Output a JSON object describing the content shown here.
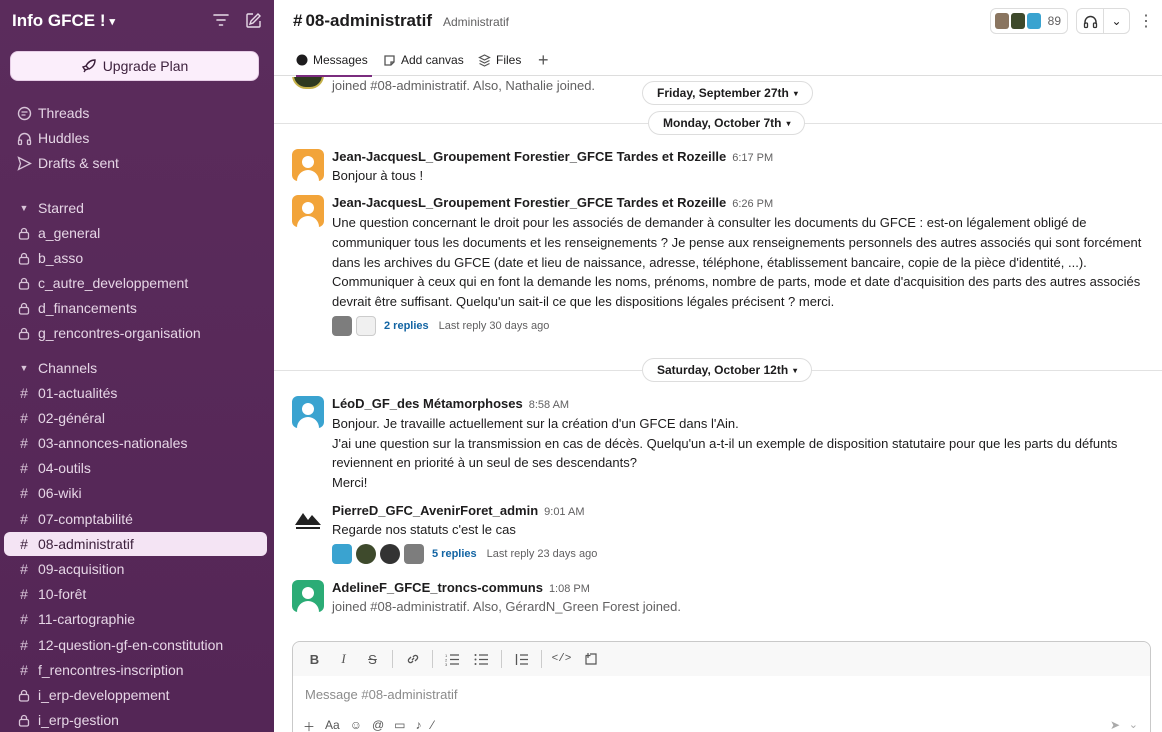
{
  "workspace": {
    "name": "Info GFCE !",
    "upgrade_label": "Upgrade Plan"
  },
  "sidebar": {
    "nav": [
      {
        "label": "Threads",
        "icon": "threads-icon"
      },
      {
        "label": "Huddles",
        "icon": "headphones-icon"
      },
      {
        "label": "Drafts & sent",
        "icon": "send-icon"
      }
    ],
    "starred": {
      "label": "Starred",
      "items": [
        "a_general",
        "b_asso",
        "c_autre_developpement",
        "d_financements",
        "g_rencontres-organisation"
      ]
    },
    "channels": {
      "label": "Channels",
      "items": [
        {
          "label": "01-actualités",
          "icon": "hash"
        },
        {
          "label": "02-général",
          "icon": "hash"
        },
        {
          "label": "03-annonces-nationales",
          "icon": "hash"
        },
        {
          "label": "04-outils",
          "icon": "hash"
        },
        {
          "label": "06-wiki",
          "icon": "hash"
        },
        {
          "label": "07-comptabilité",
          "icon": "hash"
        },
        {
          "label": "08-administratif",
          "icon": "hash",
          "active": true
        },
        {
          "label": "09-acquisition",
          "icon": "hash"
        },
        {
          "label": "10-forêt",
          "icon": "hash"
        },
        {
          "label": "11-cartographie",
          "icon": "hash"
        },
        {
          "label": "12-question-gf-en-constitution",
          "icon": "hash"
        },
        {
          "label": "f_rencontres-inscription",
          "icon": "hash"
        },
        {
          "label": "i_erp-developpement",
          "icon": "lock"
        },
        {
          "label": "i_erp-gestion",
          "icon": "lock"
        }
      ]
    }
  },
  "channel": {
    "name": "08-administratif",
    "description": "Administratif",
    "member_count": "89",
    "tabs": [
      "Messages",
      "Add canvas",
      "Files"
    ]
  },
  "feed": {
    "top_line": "joined #08-administratif. Also, Nathalie joined.",
    "dates": [
      "Friday, September 27th",
      "Monday, October 7th",
      "Saturday, October 12th"
    ],
    "messages": [
      {
        "author": "Jean-JacquesL_Groupement Forestier_GFCE Tardes et Rozeille",
        "time": "6:17 PM",
        "lines": [
          "Bonjour à tous !"
        ]
      },
      {
        "author": "Jean-JacquesL_Groupement Forestier_GFCE Tardes et Rozeille",
        "time": "6:26 PM",
        "lines": [
          "Une question concernant le droit pour les associés de demander à consulter les documents du GFCE : est-on légalement obligé de",
          "communiquer tous les documents et les renseignements ? Je pense aux renseignements personnels des autres associés qui sont forcément",
          "dans les archives du GFCE (date et lieu de naissance, adresse, téléphone, établissement bancaire, copie de la pièce d'identité, ...).",
          "Communiquer à ceux qui en font la demande les noms, prénoms, nombre de parts, mode et date d'acquisition des parts des autres associés",
          "devrait être suffisant. Quelqu'un sait-il ce que les dispositions légales précisent ? merci."
        ],
        "replies": "2 replies",
        "last_reply": "Last reply 30 days ago"
      },
      {
        "author": "LéoD_GF_des Métamorphoses",
        "time": "8:58 AM",
        "lines": [
          "Bonjour. Je travaille actuellement sur la création d'un GFCE dans l'Ain.",
          "J'ai une question sur la transmission en cas de décès. Quelqu'un a-t-il un exemple de disposition statutaire pour que les parts du défunts",
          "reviennent en priorité à un seul de ses descendants?",
          "Merci!"
        ]
      },
      {
        "author": "PierreD_GFC_AvenirForet_admin",
        "time": "9:01 AM",
        "lines": [
          "Regarde nos statuts c'est le cas"
        ],
        "replies": "5 replies",
        "last_reply": "Last reply 23 days ago"
      },
      {
        "author": "AdelineF_GFCE_troncs-communs",
        "time": "1:08 PM",
        "lines": [
          "joined #08-administratif. Also, GérardN_Green Forest joined."
        ]
      }
    ]
  },
  "composer": {
    "placeholder": "Message #08-administratif"
  },
  "colors": {
    "sidebar": "#5a2a5a",
    "accent": "#7a2c7e",
    "link": "#1264a3"
  }
}
